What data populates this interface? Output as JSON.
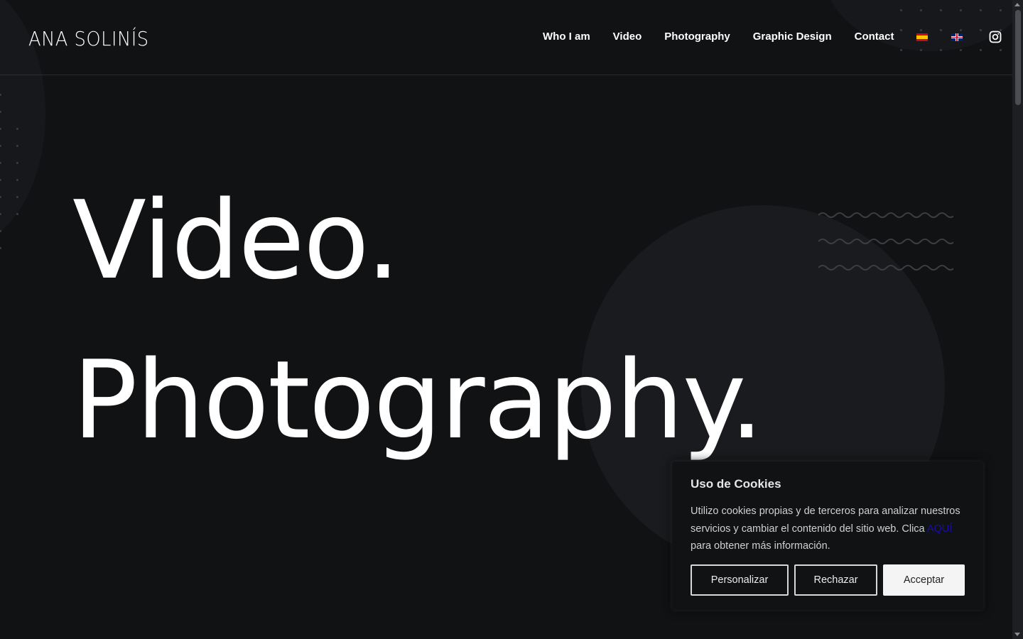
{
  "header": {
    "logo": "ANA SOLINÍS",
    "nav": [
      "Who I am",
      "Video",
      "Photography",
      "Graphic Design",
      "Contact"
    ],
    "languages": [
      "spain-flag-icon",
      "uk-flag-icon"
    ],
    "social_icon": "instagram-icon"
  },
  "hero": {
    "line1": "Video.",
    "line2": "Photography."
  },
  "cookie_banner": {
    "title": "Uso de Cookies",
    "text_before_link": "Utilizo cookies propias y de terceros para analizar nuestros servicios y cambiar el contenido del sitio web. Clica ",
    "link_text": "AQUÍ",
    "text_after_link": " para obtener más información.",
    "buttons": {
      "customize": "Personalizar",
      "reject": "Rechazar",
      "accept": "Acceptar"
    }
  },
  "colors": {
    "background": "#111214",
    "text": "#ffffff",
    "link": "#1a0dab"
  }
}
